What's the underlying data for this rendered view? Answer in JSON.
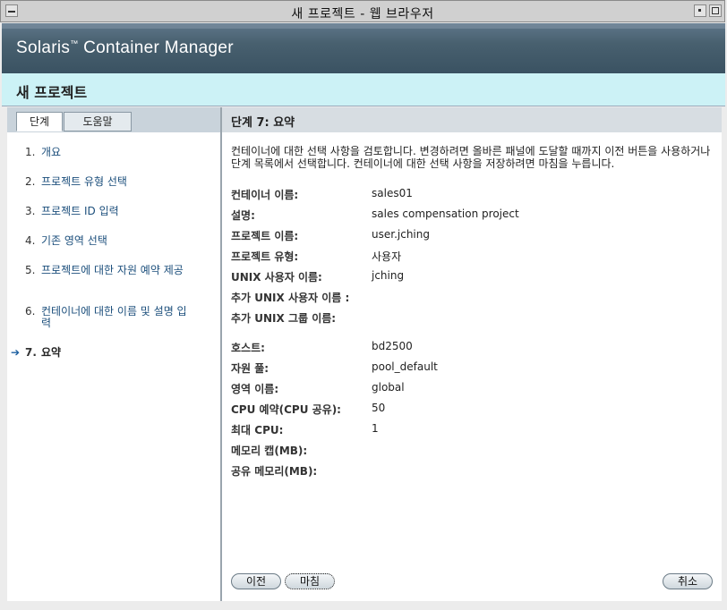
{
  "window": {
    "title": "새 프로젝트 - 웹 브라우저"
  },
  "masthead": {
    "product": "Solaris",
    "tm": "™",
    "product_rest": " Container Manager"
  },
  "page": {
    "title": "새 프로젝트"
  },
  "tabs": {
    "steps": "단계",
    "help": "도움말"
  },
  "steps": [
    {
      "num": "1.",
      "label": "개요"
    },
    {
      "num": "2.",
      "label": "프로젝트 유형 선택"
    },
    {
      "num": "3.",
      "label": "프로젝트 ID 입력"
    },
    {
      "num": "4.",
      "label": "기존 영역 선택"
    },
    {
      "num": "5.",
      "label": "프로젝트에 대한 자원 예약 제공"
    },
    {
      "num": "6.",
      "label": "컨테이너에 대한 이름 및 설명 입력"
    },
    {
      "num": "7.",
      "label": "요약"
    }
  ],
  "summary": {
    "heading": "단계 7:  요약",
    "instructions": "컨테이너에 대한 선택 사항을 검토합니다. 변경하려면 올바른 패널에 도달할 때까지 이전 버튼을 사용하거나 단계 목록에서 선택합니다. 컨테이너에 대한 선택 사항을 저장하려면 마침을 누릅니다.",
    "fields": [
      {
        "label": "컨테이너 이름:",
        "value": "sales01"
      },
      {
        "label": "설명:",
        "value": "sales compensation project"
      },
      {
        "label": "프로젝트 이름:",
        "value": "user.jching"
      },
      {
        "label": "프로젝트 유형:",
        "value": "사용자"
      },
      {
        "label": "UNIX 사용자 이름:",
        "value": "jching"
      },
      {
        "label": "추가 UNIX 사용자 이름 :",
        "value": ""
      },
      {
        "label": "추가 UNIX 그룹 이름:",
        "value": ""
      },
      {
        "label": "호스트:",
        "value": "bd2500"
      },
      {
        "label": "자원 풀:",
        "value": "pool_default"
      },
      {
        "label": "영역 이름:",
        "value": "global"
      },
      {
        "label": "CPU 예약(CPU 공유):",
        "value": "50"
      },
      {
        "label": "최대 CPU:",
        "value": "1"
      },
      {
        "label": "메모리 캡(MB):",
        "value": ""
      },
      {
        "label": "공유 메모리(MB):",
        "value": ""
      }
    ]
  },
  "buttons": {
    "previous": "이전",
    "finish": "마침",
    "cancel": "취소"
  }
}
